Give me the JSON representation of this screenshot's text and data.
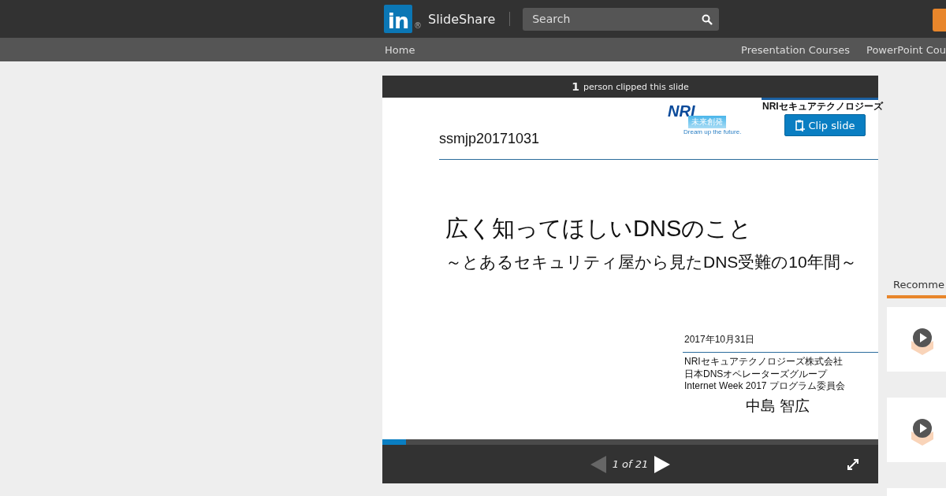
{
  "header": {
    "logo_mark": "in",
    "registered": "®",
    "brand": "SlideShare",
    "search": {
      "placeholder": "Search"
    }
  },
  "nav": {
    "home": "Home",
    "links": [
      "Presentation Courses",
      "PowerPoint Cou"
    ]
  },
  "player": {
    "clip_count": "1",
    "clip_text": "person clipped this slide",
    "clip_button": "Clip slide",
    "slide": {
      "company_logo": "NRI",
      "logo_tagline": "未来創発",
      "logo_motto": "Dream up the future.",
      "corner_company": "NRIセキュアテクノロジーズ",
      "code": "ssmjp20171031",
      "title": "広く知ってほしいDNSのこと",
      "subtitle": "～とあるセキュリティ屋から見たDNS受難の10年間～",
      "date": "2017年10月31日",
      "affiliations": [
        "NRIセキュアテクノロジーズ株式会社",
        "日本DNSオペレーターズグループ",
        "Internet Week 2017 プログラム委員会"
      ],
      "speaker": "中島 智広"
    },
    "progress": {
      "level": 0.048
    },
    "prev": {
      "disabled": true
    },
    "next": {
      "disabled": false
    },
    "page": "1 of 21"
  },
  "sidebar": {
    "heading": "Recomme",
    "cards": [
      {
        "kind": "video"
      },
      {
        "kind": "video"
      },
      {
        "kind": "empty"
      }
    ]
  }
}
